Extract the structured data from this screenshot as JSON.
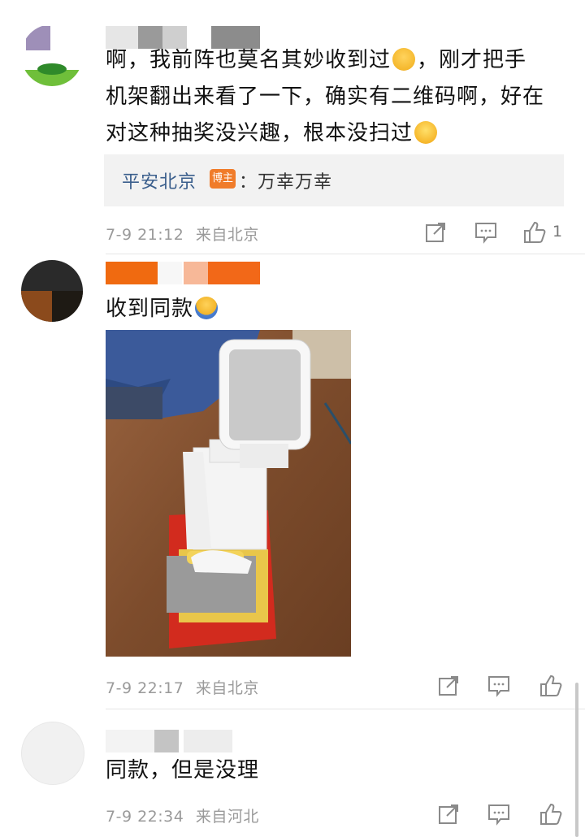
{
  "comments": [
    {
      "text": "啊，我前阵也莫名其妙收到过😓，刚才把手机架翻出来看了一下，确实有二维码啊，好在对这种抽奖没兴趣，根本没扫过😂",
      "text_line1": "啊，我前阵也莫名其妙收到过",
      "text_line1b": "，刚才把手",
      "text_line2": "机架翻出来看了一下，确实有二维码啊，好在",
      "text_line3": "对这种抽奖没兴趣，根本没扫过",
      "reply": {
        "name": "平安北京",
        "badge": "博主",
        "text": "：万幸万幸"
      },
      "time": "7-9 21:12",
      "location": "来自北京",
      "like_count": "1"
    },
    {
      "text": "收到同款",
      "time": "7-9 22:17",
      "location": "来自北京",
      "like_count": ""
    },
    {
      "text": "同款，但是没理",
      "time": "7-9 22:34",
      "location": "来自河北",
      "like_count": ""
    }
  ],
  "colors": {
    "link": "#3a5e8c",
    "badge": "#f07c2a",
    "meta": "#9a9a9a",
    "reply_bg": "#f2f2f2"
  },
  "icons": [
    "share-icon",
    "comment-icon",
    "like-icon",
    "sad-sweat-emoji",
    "laugh-cry-emoji",
    "shrug-emoji"
  ]
}
